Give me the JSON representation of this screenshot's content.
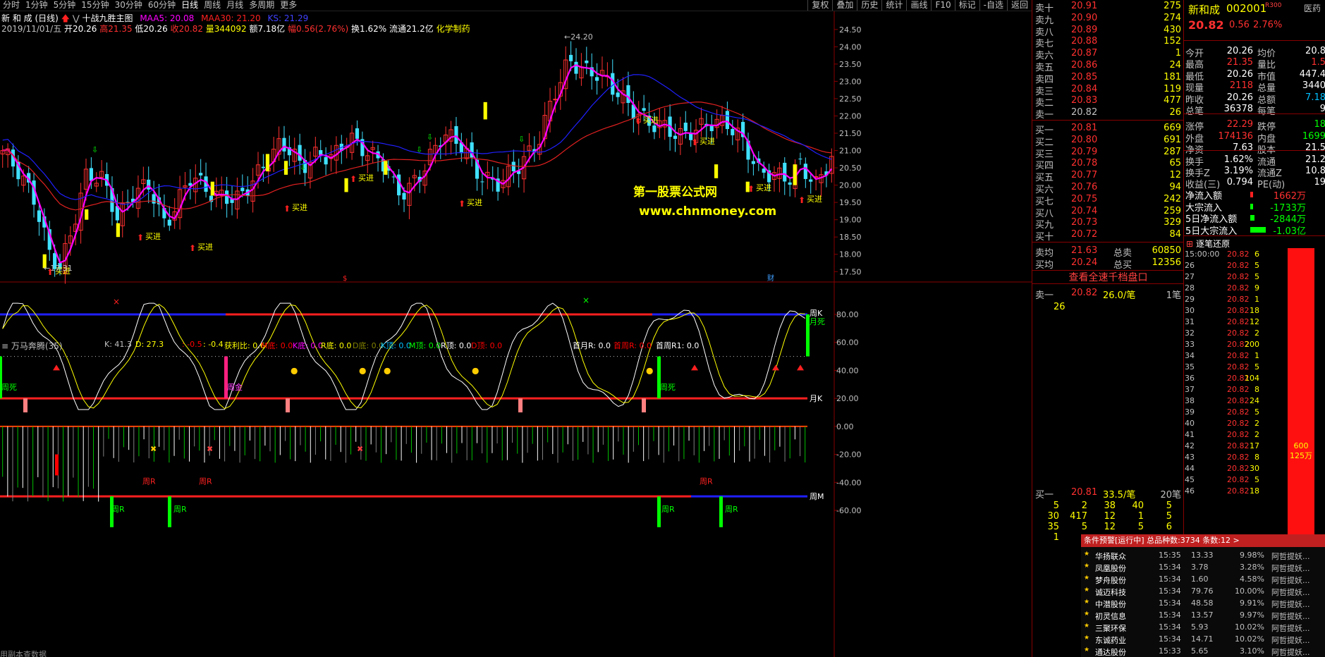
{
  "toolbar": {
    "periods": [
      "分时",
      "1分钟",
      "5分钟",
      "15分钟",
      "30分钟",
      "60分钟",
      "日线",
      "周线",
      "月线",
      "多周期",
      "更多"
    ],
    "tools": [
      "复权",
      "叠加",
      "历史",
      "统计",
      "画线",
      "F10",
      "标记",
      "-自选",
      "返回"
    ]
  },
  "chart": {
    "title_name": "新 和 成 (日线)",
    "indicator_name": "十战九胜主图",
    "ma5": "MAA5: 20.08",
    "ma30": "MAA30: 21.20",
    "ks": "KS: 21.29",
    "info_line": {
      "date": "2019/11/01/五",
      "open": "开20.26",
      "high": "高21.35",
      "low": "低20.26",
      "close": "收20.82",
      "vol": "量344092",
      "amount": "额7.18亿",
      "range": "幅0.56(2.76%)",
      "turnover": "换1.62%",
      "float": "流通21.2亿",
      "sector": "化学制药"
    },
    "price_axis": [
      "24.50",
      "24.00",
      "23.50",
      "23.00",
      "22.50",
      "22.00",
      "21.50",
      "21.00",
      "20.50",
      "20.00",
      "19.50",
      "19.00",
      "18.50",
      "18.00",
      "17.50"
    ],
    "high_label": "24.20",
    "low_label": "17.31",
    "buy_label": "买进",
    "watermark": {
      "name": "第一股票公式网",
      "url": "www.chnmoney.com"
    },
    "markers": {
      "s": "$",
      "cai": "财"
    }
  },
  "indicator": {
    "name": "万马奔腾(35)",
    "values": [
      {
        "k": "K: 41.3",
        "c": "#c0c0c0"
      },
      {
        "k": "D: 27.3",
        "c": "#ffff00"
      },
      {
        "k": ": -0.5",
        "c": "#ff0000"
      },
      {
        "k": ": -0.4",
        "c": "#ffff00"
      },
      {
        "k": "获利比: 0.6",
        "c": "#ffff00"
      },
      {
        "k": "M底: 0.0",
        "c": "#ff0000"
      },
      {
        "k": "K底: 0.0",
        "c": "#ff00ff"
      },
      {
        "k": "R底: 0.0",
        "c": "#ffff00"
      },
      {
        "k": "D底: 0.0",
        "c": "#808000"
      },
      {
        "k": "K顶: 0.0",
        "c": "#00c0ff"
      },
      {
        "k": "M顶: 0.0",
        "c": "#00ff00"
      },
      {
        "k": "R顶: 0.0",
        "c": "#ffffff"
      },
      {
        "k": "D顶: 0.0",
        "c": "#ff0000"
      },
      {
        "k": "首月R: 0.0",
        "c": "#ffffff"
      },
      {
        "k": "首周R: 0.0",
        "c": "#ff0000"
      },
      {
        "k": "首周R1: 0.0",
        "c": "#ffffff"
      }
    ],
    "axis": [
      "80.00",
      "60.00",
      "40.00",
      "20.00",
      "0.00",
      "-20.00",
      "-40.00",
      "-60.00"
    ],
    "labels": {
      "zhouk": "周K",
      "yuesi": "月死",
      "yuek": "月K",
      "zhoum": "周M",
      "zhousi": "周死",
      "zhoujin": "周金",
      "zhour": "周R"
    },
    "bottom_text": "用副本查数据"
  },
  "orderbook": {
    "sells": [
      {
        "l": "卖十",
        "p": "20.91",
        "v": "275"
      },
      {
        "l": "卖九",
        "p": "20.90",
        "v": "274"
      },
      {
        "l": "卖八",
        "p": "20.89",
        "v": "430"
      },
      {
        "l": "卖七",
        "p": "20.88",
        "v": "152"
      },
      {
        "l": "卖六",
        "p": "20.87",
        "v": "1"
      },
      {
        "l": "卖五",
        "p": "20.86",
        "v": "24"
      },
      {
        "l": "卖四",
        "p": "20.85",
        "v": "181"
      },
      {
        "l": "卖三",
        "p": "20.84",
        "v": "119"
      },
      {
        "l": "卖二",
        "p": "20.83",
        "v": "477"
      },
      {
        "l": "卖一",
        "p": "20.82",
        "v": "26"
      }
    ],
    "buys": [
      {
        "l": "买一",
        "p": "20.81",
        "v": "669"
      },
      {
        "l": "买二",
        "p": "20.80",
        "v": "691"
      },
      {
        "l": "买三",
        "p": "20.79",
        "v": "287"
      },
      {
        "l": "买四",
        "p": "20.78",
        "v": "65"
      },
      {
        "l": "买五",
        "p": "20.77",
        "v": "12"
      },
      {
        "l": "买六",
        "p": "20.76",
        "v": "94"
      },
      {
        "l": "买七",
        "p": "20.75",
        "v": "242"
      },
      {
        "l": "买八",
        "p": "20.74",
        "v": "259"
      },
      {
        "l": "买九",
        "p": "20.73",
        "v": "329"
      },
      {
        "l": "买十",
        "p": "20.72",
        "v": "84"
      }
    ],
    "sell_avg": {
      "l": "卖均",
      "p": "21.63",
      "tl": "总卖",
      "tv": "60850"
    },
    "buy_avg": {
      "l": "买均",
      "p": "20.24",
      "tl": "总买",
      "tv": "12356"
    },
    "view_button": "查看全速千档盘口",
    "sell1_detail": {
      "l": "卖一",
      "p": "20.82",
      "per": "26.0/笔",
      "cnt": "1笔",
      "q": "26"
    },
    "buy1_detail": {
      "l": "买一",
      "p": "20.81",
      "per": "33.5/笔",
      "cnt": "20笔"
    },
    "buy_queue": [
      [
        "5",
        "2",
        "38",
        "40",
        "5"
      ],
      [
        "30",
        "417",
        "12",
        "1",
        "5"
      ],
      [
        "35",
        "5",
        "12",
        "5",
        "6"
      ],
      [
        "1",
        "",
        "",
        "",
        ""
      ]
    ]
  },
  "quote": {
    "name": "新和成",
    "code": "002001",
    "tag": "R300",
    "price": "20.82",
    "change": "0.56",
    "pct": "2.76%",
    "ctrl": "医药",
    "rows": [
      [
        "今开",
        "20.26",
        "均价",
        "20.8"
      ],
      [
        "最高",
        "21.35",
        "量比",
        "1.5"
      ],
      [
        "最低",
        "20.26",
        "市值",
        "447.4"
      ],
      [
        "现量",
        "2118",
        "总量",
        "3440"
      ],
      [
        "昨收",
        "20.26",
        "总额",
        "7.18"
      ],
      [
        "总笔",
        "36378",
        "每笔",
        "9"
      ],
      [
        "涨停",
        "22.29",
        "跌停",
        "18"
      ],
      [
        "外盘",
        "174136",
        "内盘",
        "1699"
      ],
      [
        "净资",
        "7.63",
        "股本",
        "21.5"
      ],
      [
        "换手",
        "1.62%",
        "流通",
        "21.2"
      ],
      [
        "换手Z",
        "3.19%",
        "流通Z",
        "10.8"
      ],
      [
        "收益(三)",
        "0.794",
        "PE(动)",
        "19"
      ]
    ],
    "flows": [
      {
        "l": "净流入额",
        "v": "1662万"
      },
      {
        "l": "大宗流入",
        "v": "-1733万"
      },
      {
        "l": "5日净流入额",
        "v": "-2844万"
      },
      {
        "l": "5日大宗流入",
        "v": "-1.03亿"
      }
    ]
  },
  "ticks": {
    "title": "逐笔还原",
    "rows": [
      [
        "15:00:00",
        "20.82",
        "6"
      ],
      [
        "26",
        "20.82",
        "5"
      ],
      [
        "27",
        "20.82",
        "5"
      ],
      [
        "28",
        "20.82",
        "9"
      ],
      [
        "29",
        "20.82",
        "1"
      ],
      [
        "30",
        "20.82",
        "18"
      ],
      [
        "31",
        "20.82",
        "12"
      ],
      [
        "32",
        "20.82",
        "2"
      ],
      [
        "33",
        "20.82",
        "200"
      ],
      [
        "34",
        "20.82",
        "1"
      ],
      [
        "35",
        "20.82",
        "5"
      ],
      [
        "36",
        "20.82",
        "104"
      ],
      [
        "37",
        "20.82",
        "8"
      ],
      [
        "38",
        "20.82",
        "24"
      ],
      [
        "39",
        "20.82",
        "5"
      ],
      [
        "40",
        "20.82",
        "2"
      ],
      [
        "41",
        "20.82",
        "2"
      ],
      [
        "42",
        "20.82",
        "17"
      ],
      [
        "43",
        "20.82",
        "8"
      ],
      [
        "44",
        "20.82",
        "30"
      ],
      [
        "45",
        "20.82",
        "5"
      ],
      [
        "46",
        "20.82",
        "18"
      ]
    ],
    "bar_label": "600\n125万"
  },
  "alerts": {
    "header": "条件预警[运行中] 总品种数:3734 条数:12",
    "rows": [
      [
        "华扬联众",
        "15:35",
        "13.33",
        "9.98%",
        "阿哲提妖..."
      ],
      [
        "凤凰股份",
        "15:34",
        "3.78",
        "3.28%",
        "阿哲提妖..."
      ],
      [
        "梦舟股份",
        "15:34",
        "1.60",
        "4.58%",
        "阿哲提妖..."
      ],
      [
        "诚迈科技",
        "15:34",
        "79.76",
        "10.00%",
        "阿哲提妖..."
      ],
      [
        "中潜股份",
        "15:34",
        "48.58",
        "9.91%",
        "阿哲提妖..."
      ],
      [
        "初灵信息",
        "15:34",
        "13.57",
        "9.97%",
        "阿哲提妖..."
      ],
      [
        "三聚环保",
        "15:34",
        "5.93",
        "10.02%",
        "阿哲提妖..."
      ],
      [
        "东诚药业",
        "15:34",
        "14.71",
        "10.02%",
        "阿哲提妖..."
      ],
      [
        "通达股份",
        "15:33",
        "5.65",
        "3.10%",
        "阿哲提妖..."
      ]
    ]
  }
}
